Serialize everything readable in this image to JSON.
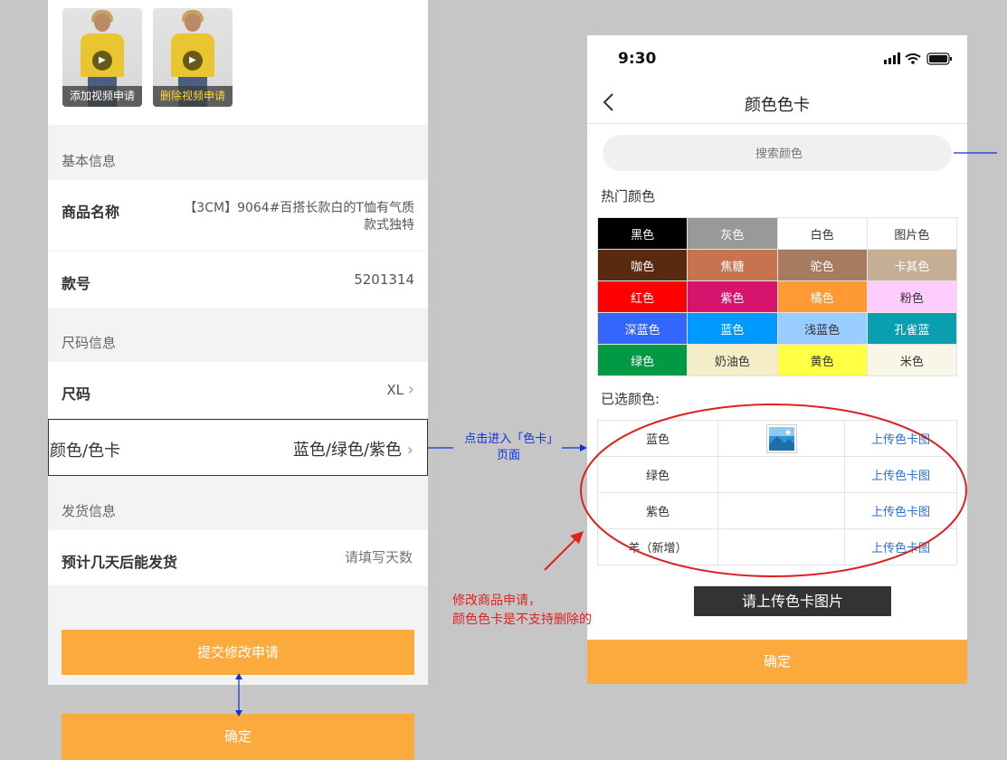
{
  "left": {
    "videos": [
      {
        "caption": "添加视频申请",
        "play_icon": "play-icon"
      },
      {
        "caption": "删除视频申请",
        "play_icon": "play-icon"
      }
    ],
    "basic_info": {
      "title": "基本信息",
      "name_label": "商品名称",
      "name_value_line1": "【3CM】9064#百搭长款白的T恤有气质",
      "name_value_line2": "款式独特",
      "sku_label": "款号",
      "sku_value": "5201314"
    },
    "size_info": {
      "title": "尺码信息",
      "size_label": "尺码",
      "size_value": "XL",
      "color_label": "颜色/色卡",
      "color_value": "蓝色/绿色/紫色"
    },
    "shipping": {
      "title": "发货信息",
      "days_label": "预计几天后能发货",
      "days_placeholder": "请填写天数"
    },
    "submit_label": "提交修改申请",
    "confirm_label": "确定"
  },
  "annotations": {
    "enter_color_page": "点击进入「色卡」页面",
    "note_line1": "修改商品申请，",
    "note_line2": "颜色色卡是不支持删除的"
  },
  "phone": {
    "status": {
      "time": "9:30"
    },
    "nav": {
      "title": "颜色色卡"
    },
    "search": {
      "placeholder": "搜索颜色"
    },
    "hot_colors": {
      "title": "热门颜色",
      "rows": [
        [
          {
            "name": "黑色",
            "bg": "#000000",
            "fg": "#ffffff"
          },
          {
            "name": "灰色",
            "bg": "#999999",
            "fg": "#ffffff"
          },
          {
            "name": "白色",
            "bg": "#ffffff",
            "fg": "#333333"
          },
          {
            "name": "图片色",
            "bg": "#ffffff",
            "fg": "#333333"
          }
        ],
        [
          {
            "name": "咖色",
            "bg": "#5a2a10",
            "fg": "#ffffff"
          },
          {
            "name": "焦糖",
            "bg": "#c8734f",
            "fg": "#ffffff"
          },
          {
            "name": "驼色",
            "bg": "#a67c61",
            "fg": "#ffffff"
          },
          {
            "name": "卡其色",
            "bg": "#c6ae95",
            "fg": "#ffffff"
          }
        ],
        [
          {
            "name": "红色",
            "bg": "#ff0000",
            "fg": "#ffffff"
          },
          {
            "name": "紫色",
            "bg": "#d6136d",
            "fg": "#ffffff"
          },
          {
            "name": "橘色",
            "bg": "#ff9933",
            "fg": "#ffffff"
          },
          {
            "name": "粉色",
            "bg": "#ffccff",
            "fg": "#333333"
          }
        ],
        [
          {
            "name": "深蓝色",
            "bg": "#3366ff",
            "fg": "#ffffff"
          },
          {
            "name": "蓝色",
            "bg": "#0099ff",
            "fg": "#ffffff"
          },
          {
            "name": "浅蓝色",
            "bg": "#99ccff",
            "fg": "#333333"
          },
          {
            "name": "孔雀蓝",
            "bg": "#0a9fb0",
            "fg": "#ffffff"
          }
        ],
        [
          {
            "name": "绿色",
            "bg": "#009944",
            "fg": "#ffffff"
          },
          {
            "name": "奶油色",
            "bg": "#f5edc8",
            "fg": "#333333"
          },
          {
            "name": "黄色",
            "bg": "#ffff44",
            "fg": "#333333"
          },
          {
            "name": "米色",
            "bg": "#f8f6e6",
            "fg": "#333333"
          }
        ]
      ]
    },
    "selected": {
      "title": "已选颜色:",
      "rows": [
        {
          "name": "蓝色",
          "has_image": true,
          "upload": "上传色卡图"
        },
        {
          "name": "绿色",
          "has_image": false,
          "upload": "上传色卡图"
        },
        {
          "name": "紫色",
          "has_image": false,
          "upload": "上传色卡图"
        },
        {
          "name": "羊（新增）",
          "has_image": false,
          "upload": "上传色卡图"
        }
      ]
    },
    "upload_tip": "请上传色卡图片",
    "confirm_label": "确定"
  },
  "colors": {
    "accent_orange": "#fbab3e",
    "link_blue": "#2a6fd6",
    "annotation_blue": "#1030d8",
    "annotation_red": "#e02020"
  }
}
